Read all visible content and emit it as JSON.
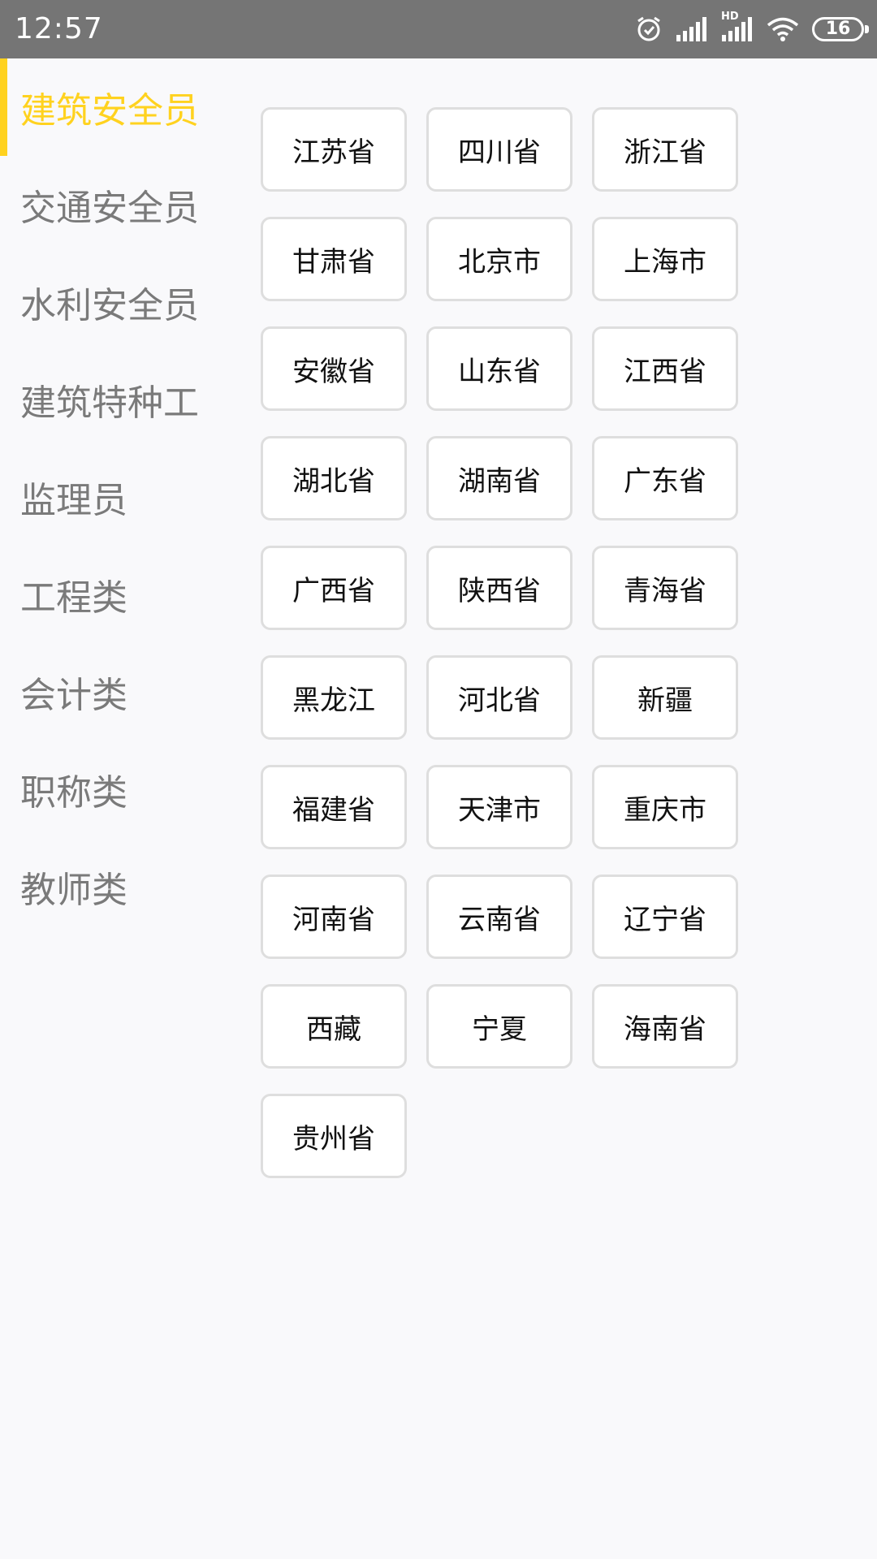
{
  "status_bar": {
    "time": "12:57",
    "hd_label": "HD",
    "battery_level": "16",
    "icons": [
      "alarm-icon",
      "cell-signal-icon",
      "hd-signal-icon",
      "wifi-icon",
      "battery-icon"
    ]
  },
  "sidebar": {
    "accent_color": "#ffd21f",
    "items": [
      {
        "label": "建筑安全员",
        "active": true
      },
      {
        "label": "交通安全员",
        "active": false
      },
      {
        "label": "水利安全员",
        "active": false
      },
      {
        "label": "建筑特种工",
        "active": false
      },
      {
        "label": "监理员",
        "active": false
      },
      {
        "label": "工程类",
        "active": false
      },
      {
        "label": "会计类",
        "active": false
      },
      {
        "label": "职称类",
        "active": false
      },
      {
        "label": "教师类",
        "active": false
      }
    ]
  },
  "regions": [
    "江苏省",
    "四川省",
    "浙江省",
    "甘肃省",
    "北京市",
    "上海市",
    "安徽省",
    "山东省",
    "江西省",
    "湖北省",
    "湖南省",
    "广东省",
    "广西省",
    "陕西省",
    "青海省",
    "黑龙江",
    "河北省",
    "新疆",
    "福建省",
    "天津市",
    "重庆市",
    "河南省",
    "云南省",
    "辽宁省",
    "西藏",
    "宁夏",
    "海南省",
    "贵州省"
  ]
}
